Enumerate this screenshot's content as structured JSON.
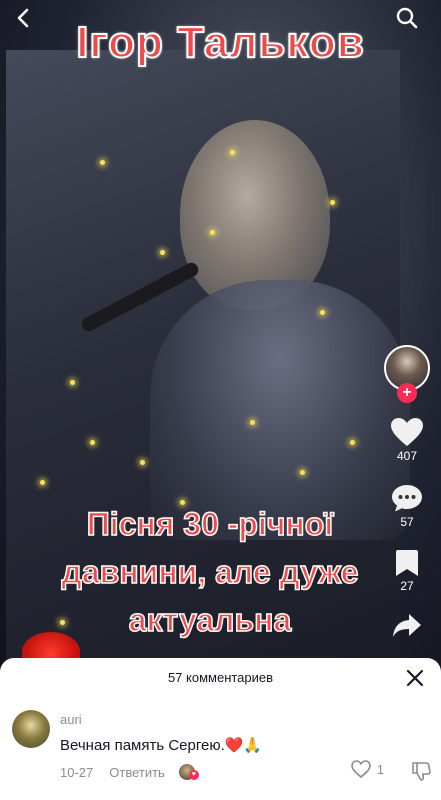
{
  "video": {
    "title_overlay": "Ігор Тальков",
    "caption_lines": [
      "Пісня  30 -річної",
      "давнини, але дуже",
      "актуальна"
    ]
  },
  "actions": {
    "likes": "407",
    "comments": "57",
    "saves": "27",
    "follow_label": "+"
  },
  "icons": {
    "back": "chevron-left-icon",
    "search": "search-icon",
    "like": "heart-icon",
    "comment": "comment-bubble-icon",
    "save": "bookmark-icon",
    "share": "share-arrow-icon",
    "close": "close-icon"
  },
  "comments_panel": {
    "header": "57 комментариев",
    "comments": [
      {
        "user": "auri",
        "text": "Вечная память Сергею.❤️🙏",
        "date": "10-27",
        "reply_label": "Ответить",
        "likes": "1"
      }
    ]
  },
  "colors": {
    "title_red": "#ef4a4a",
    "follow_pink": "#fe2c55",
    "spark_yellow": "#f7e05a"
  }
}
